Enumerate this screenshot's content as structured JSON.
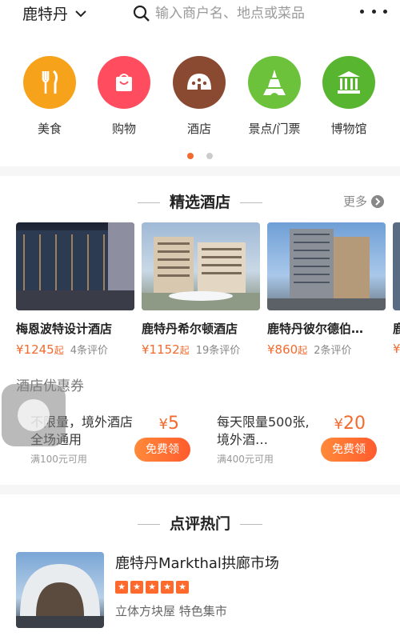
{
  "header": {
    "city": "鹿特丹",
    "search_placeholder": "输入商户名、地点或菜品"
  },
  "categories": [
    {
      "label": "美食",
      "icon": "fork-knife-icon",
      "color": "#f7a21b"
    },
    {
      "label": "购物",
      "icon": "shopping-bag-icon",
      "color": "#ff4d5f"
    },
    {
      "label": "酒店",
      "icon": "hotel-dome-icon",
      "color": "#8a4a32"
    },
    {
      "label": "景点/门票",
      "icon": "tower-icon",
      "color": "#6cc23a"
    },
    {
      "label": "博物馆",
      "icon": "museum-icon",
      "color": "#58b52f"
    }
  ],
  "pager": {
    "active": "#f26a2d",
    "inactive": "#cccccc"
  },
  "hotels_section": {
    "title": "精选酒店",
    "more": "更多",
    "items": [
      {
        "name": "梅恩波特设计酒店",
        "price": "¥1245",
        "unit": "起",
        "reviews": "4条评价"
      },
      {
        "name": "鹿特丹希尔顿酒店",
        "price": "¥1152",
        "unit": "起",
        "reviews": "19条评价"
      },
      {
        "name": "鹿特丹彼尔德伯…",
        "price": "¥860",
        "unit": "起",
        "reviews": "2条评价"
      },
      {
        "name": "鹿",
        "price": "¥",
        "unit": "",
        "reviews": ""
      }
    ]
  },
  "coupons_section": {
    "title": "酒店优惠券",
    "items": [
      {
        "desc": "不限量，境外酒店全场通用",
        "cond": "满100元可用",
        "currency": "¥",
        "amount": "5",
        "button": "免费领"
      },
      {
        "desc": "每天限量500张,境外酒…",
        "cond": "满400元可用",
        "currency": "¥",
        "amount": "20",
        "button": "免费领"
      }
    ]
  },
  "reviews_section": {
    "title": "点评热门",
    "items": [
      {
        "name": "鹿特丹Markthal拱廊市场",
        "rating": 5,
        "tags": "立体方块屋  特色集市"
      }
    ]
  },
  "colors": {
    "accent": "#f26a2d"
  }
}
